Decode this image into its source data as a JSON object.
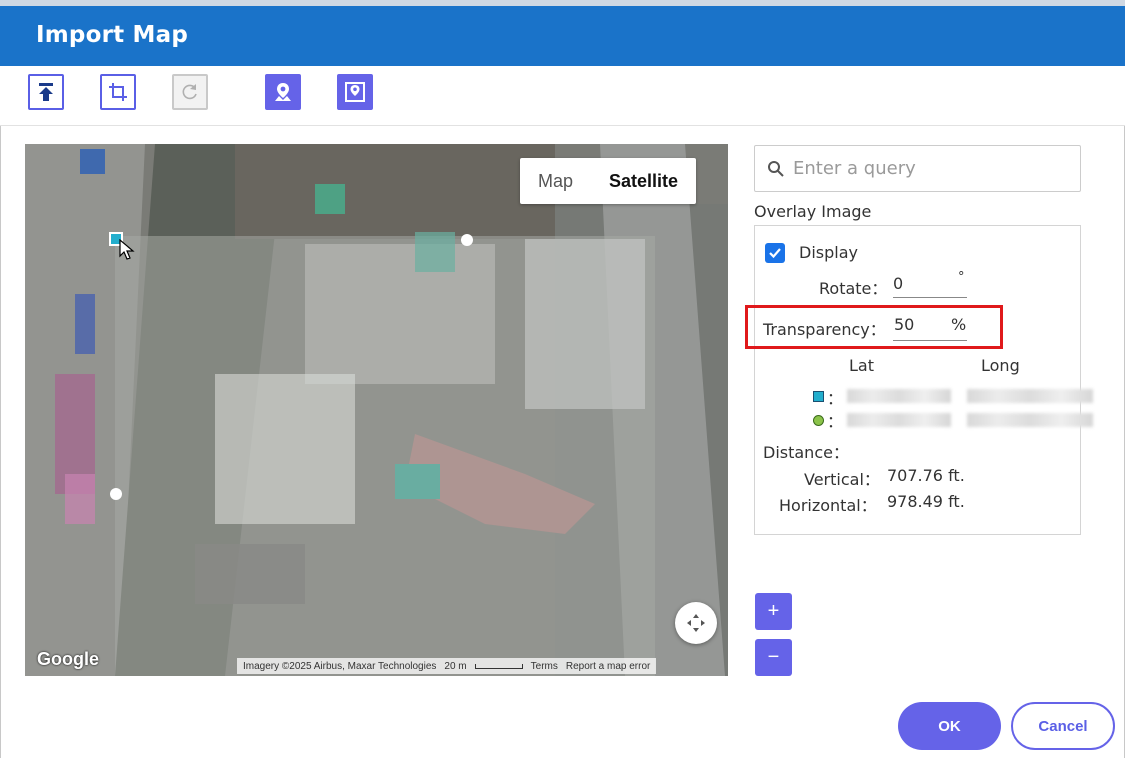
{
  "dialog": {
    "title": "Import Map"
  },
  "toolbar": {
    "buttons": [
      {
        "name": "upload-top-icon"
      },
      {
        "name": "crop-icon"
      },
      {
        "name": "rotate-icon"
      },
      {
        "name": "map-pin-icon"
      },
      {
        "name": "image-location-icon"
      }
    ]
  },
  "map": {
    "toggle": {
      "map_label": "Map",
      "satellite_label": "Satellite",
      "selected": "Satellite"
    },
    "logo": "Google",
    "attribution": "Imagery ©2025 Airbus, Maxar Technologies",
    "scale": "20 m",
    "terms": "Terms",
    "report": "Report a map error"
  },
  "search": {
    "placeholder": "Enter a query",
    "value": ""
  },
  "overlay": {
    "title": "Overlay Image",
    "display_label": "Display",
    "display_checked": true,
    "rotate_label": "Rotate：",
    "rotate_value": "0",
    "rotate_unit": "°",
    "transparency_label": "Transparency：",
    "transparency_value": "50",
    "transparency_unit": "%",
    "lat_header": "Lat",
    "long_header": "Long",
    "point_sep": "：",
    "distance_label": "Distance：",
    "vertical_label": "Vertical：",
    "vertical_value": "707.76 ft.",
    "horizontal_label": "Horizontal：",
    "horizontal_value": "978.49 ft."
  },
  "zoom": {
    "plus": "+",
    "minus": "−"
  },
  "footer": {
    "ok_label": "OK",
    "cancel_label": "Cancel"
  },
  "colors": {
    "accent": "#6563e8",
    "titlebar": "#1a73c9",
    "highlight": "#e0191b",
    "marker_square": "#22aecd",
    "marker_circle": "#8bc34a"
  }
}
